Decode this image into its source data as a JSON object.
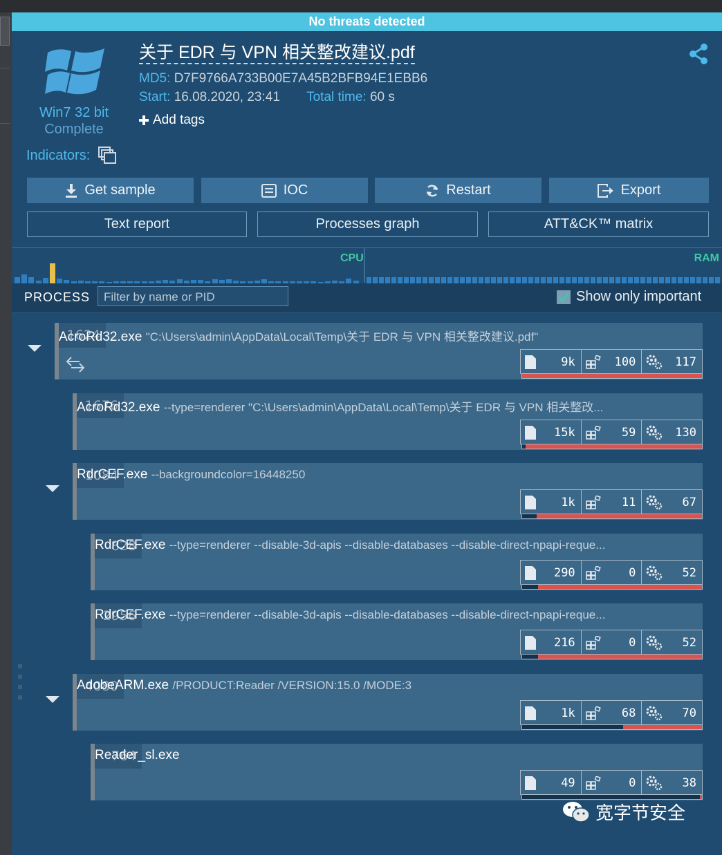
{
  "banner": "No threats detected",
  "os": {
    "name": "Win7 32 bit",
    "status": "Complete"
  },
  "indicators_label": "Indicators:",
  "file": {
    "title": "关于 EDR 与 VPN 相关整改建议.pdf",
    "md5_label": "MD5:",
    "md5": "D7F9766A733B00E7A45B2BFB94E1EBB6",
    "start_label": "Start:",
    "start": "16.08.2020, 23:41",
    "total_label": "Total time:",
    "total": "60 s"
  },
  "add_tags": "Add tags",
  "actions": {
    "get_sample": "Get sample",
    "ioc": "IOC",
    "restart": "Restart",
    "export": "Export"
  },
  "views": {
    "text_report": "Text report",
    "processes_graph": "Processes graph",
    "attck": "ATT&CK™ matrix"
  },
  "graph": {
    "cpu": "CPU",
    "ram": "RAM"
  },
  "process_bar": {
    "label": "PROCESS",
    "filter_placeholder": "Filter by name or PID",
    "important": "Show only important",
    "important_checked": true
  },
  "processes": [
    {
      "pid": "1624",
      "name": "AcroRd32.exe",
      "args": "\"C:\\Users\\admin\\AppData\\Local\\Temp\\关于 EDR 与 VPN 相关整改建议.pdf\"",
      "files": "9k",
      "reg": "100",
      "mods": "117",
      "usage": 1.0
    },
    {
      "pid": "1676",
      "name": "AcroRd32.exe",
      "args": "--type=renderer \"C:\\Users\\admin\\AppData\\Local\\Temp\\关于 EDR 与 VPN 相关整改...",
      "files": "15k",
      "reg": "59",
      "mods": "130",
      "usage": 0.98
    },
    {
      "pid": "1084",
      "name": "RdrCEF.exe",
      "args": "--backgroundcolor=16448250",
      "files": "1k",
      "reg": "11",
      "mods": "67",
      "usage": 0.92
    },
    {
      "pid": "828",
      "name": "RdrCEF.exe",
      "args": "--type=renderer --disable-3d-apis --disable-databases --disable-direct-npapi-reque...",
      "files": "290",
      "reg": "0",
      "mods": "52",
      "usage": 0.91
    },
    {
      "pid": "2956",
      "name": "RdrCEF.exe",
      "args": "--type=renderer --disable-3d-apis --disable-databases --disable-direct-npapi-reque...",
      "files": "216",
      "reg": "0",
      "mods": "52",
      "usage": 0.91
    },
    {
      "pid": "4080",
      "name": "AdobeARM.exe",
      "args": "/PRODUCT:Reader /VERSION:15.0 /MODE:3",
      "files": "1k",
      "reg": "68",
      "mods": "70",
      "usage": 0.44
    },
    {
      "pid": "764",
      "name": "Reader_sl.exe",
      "args": "",
      "files": "49",
      "reg": "0",
      "mods": "38",
      "usage": 0.01
    }
  ],
  "watermark": "宽字节安全"
}
